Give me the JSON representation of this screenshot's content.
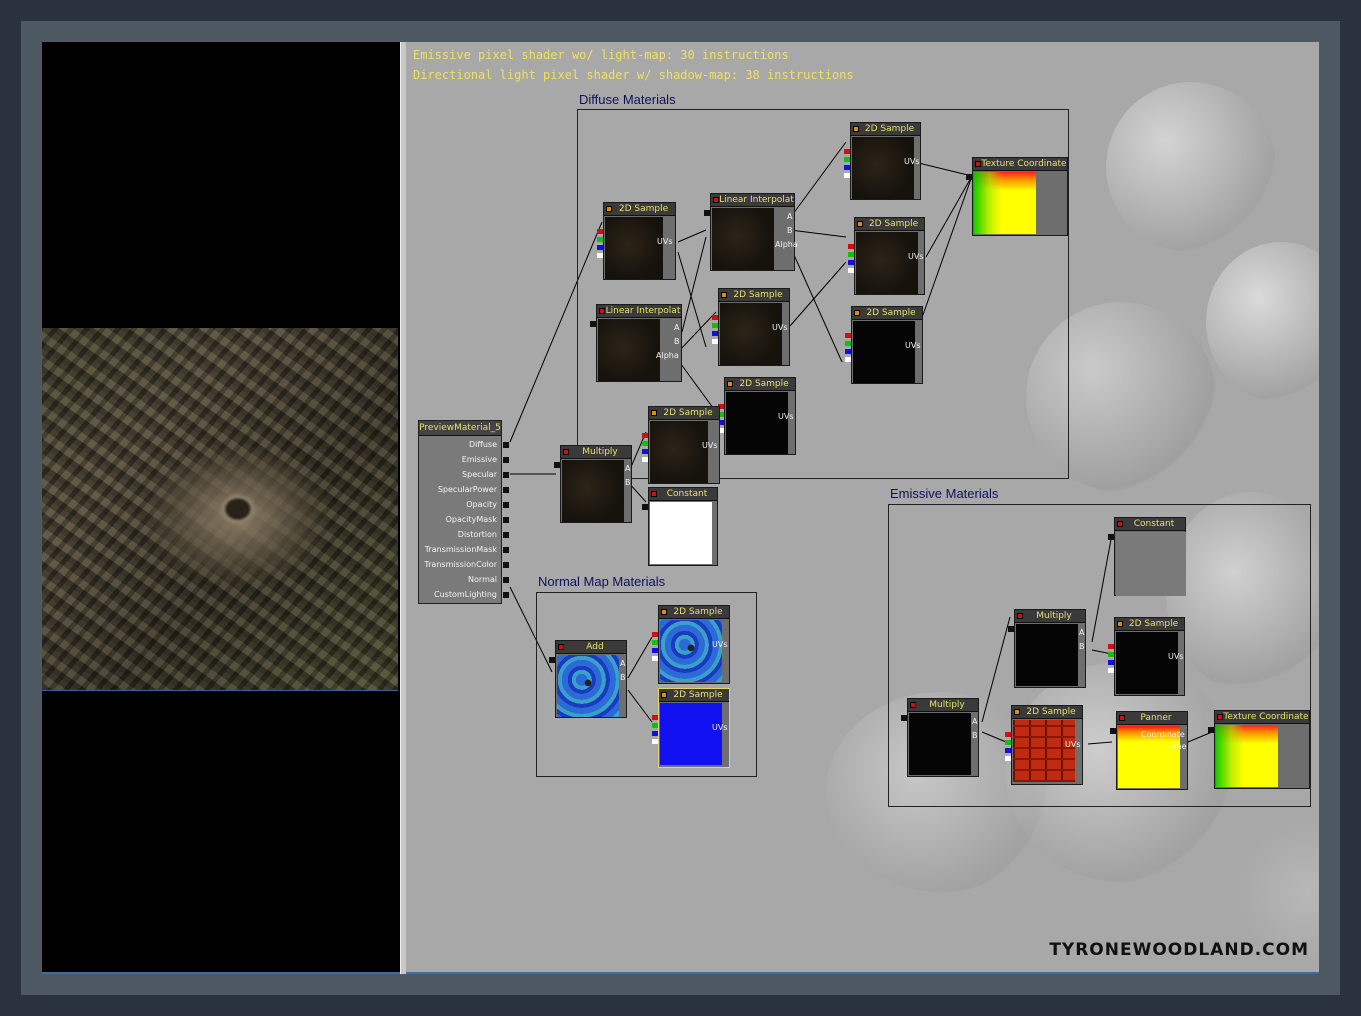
{
  "info_lines": [
    "Emissive pixel shader wo/ light-map: 30 instructions",
    "Directional light pixel shader w/ shadow-map: 38 instructions"
  ],
  "groups": {
    "diffuse": "Diffuse Materials",
    "normal": "Normal Map Materials",
    "emissive": "Emissive Materials"
  },
  "root_node": {
    "title": "PreviewMaterial_5",
    "inputs": [
      "Diffuse",
      "Emissive",
      "Specular",
      "SpecularPower",
      "Opacity",
      "OpacityMask",
      "Distortion",
      "TransmissionMask",
      "TransmissionColor",
      "Normal",
      "CustomLighting"
    ]
  },
  "nodes": {
    "d_sample1": "2D Sample",
    "d_sample2": "2D Sample",
    "d_sample3": "2D Sample",
    "d_sample4": "2D Sample",
    "d_sample5": "2D Sample",
    "d_sample6": "2D Sample",
    "d_sample7": "2D Sample",
    "d_lerp1": "Linear Interpolat",
    "d_lerp2": "Linear Interpolat",
    "d_texcoord": "Texture Coordinate",
    "d_multiply": "Multiply",
    "d_constant": "Constant",
    "n_add": "Add",
    "n_sample1": "2D Sample",
    "n_sample2": "2D Sample",
    "e_constant": "Constant",
    "e_multiply1": "Multiply",
    "e_sample1": "2D Sample",
    "e_multiply2": "Multiply",
    "e_sample2": "2D Sample",
    "e_panner": "Panner",
    "e_texcoord": "Texture Coordinate"
  },
  "port_labels": {
    "uvs": "UVs",
    "a": "A",
    "b": "B",
    "alpha": "Alpha",
    "coordinate": "Coordinate",
    "time": "Time"
  },
  "watermark": "TYRONEWOODLAND.COM"
}
